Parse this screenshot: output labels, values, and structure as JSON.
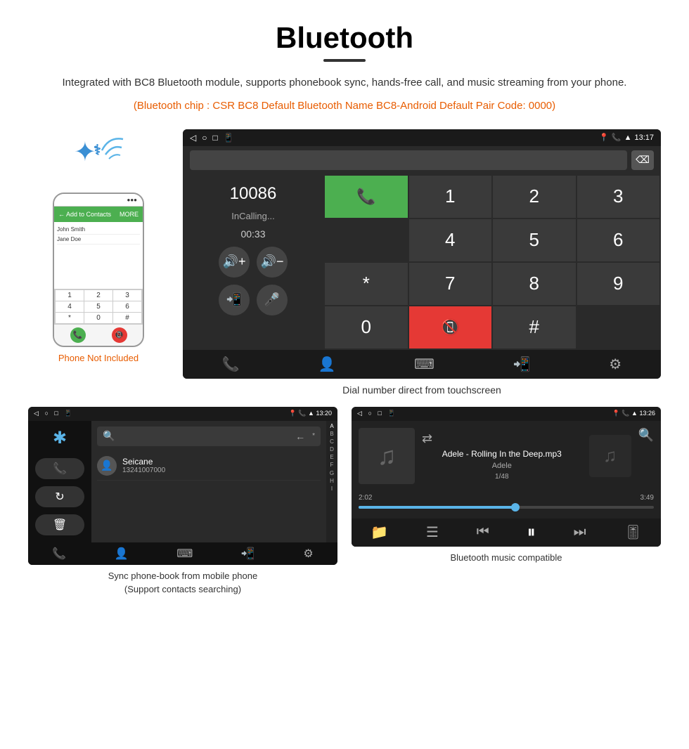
{
  "header": {
    "title": "Bluetooth",
    "description": "Integrated with BC8 Bluetooth module, supports phonebook sync, hands-free call, and music streaming from your phone.",
    "orange_info": "(Bluetooth chip : CSR BC8    Default Bluetooth Name BC8-Android    Default Pair Code: 0000)"
  },
  "dial_screen": {
    "status_time": "13:17",
    "number": "10086",
    "call_status": "InCalling...",
    "call_duration": "00:33",
    "keys": [
      "1",
      "2",
      "3",
      "*",
      "4",
      "5",
      "6",
      "0",
      "7",
      "8",
      "9",
      "#"
    ],
    "caption": "Dial number direct from touchscreen"
  },
  "contacts_screen": {
    "status_time": "13:20",
    "contact_name": "Seicane",
    "contact_number": "13241007000",
    "alpha_letters": [
      "A",
      "B",
      "C",
      "D",
      "E",
      "F",
      "G",
      "H",
      "I"
    ],
    "caption_line1": "Sync phone-book from mobile phone",
    "caption_line2": "(Support contacts searching)"
  },
  "music_screen": {
    "status_time": "13:26",
    "song_title": "Adele - Rolling In the Deep.mp3",
    "artist": "Adele",
    "track_info": "1/48",
    "time_current": "2:02",
    "time_total": "3:49",
    "progress_percent": 53,
    "caption": "Bluetooth music compatible"
  },
  "phone_image": {
    "not_included_label": "Phone Not Included"
  }
}
